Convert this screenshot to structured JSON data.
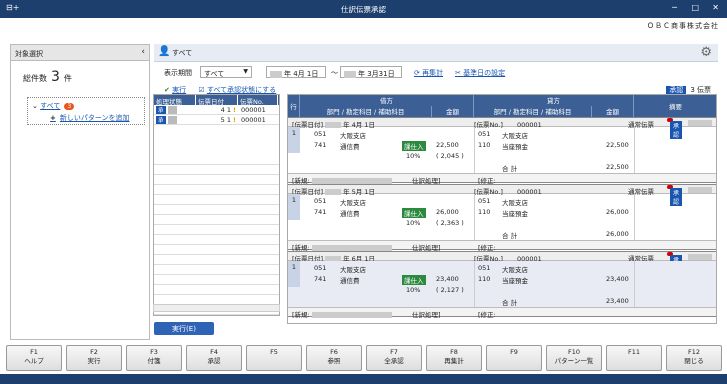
{
  "window": {
    "title": "仕訳伝票承認",
    "company": "ＯＢＣ商事株式会社",
    "controls": [
      "─",
      "□",
      "✕"
    ]
  },
  "left": {
    "header": "対象選択",
    "total_label": "総件数",
    "total_count": "3",
    "total_unit": "件",
    "tree_root": "すべて",
    "tree_badge": "3",
    "tree_add": "新しいパターンを追加"
  },
  "main": {
    "header": "すべて",
    "period_label": "表示期間",
    "period_value": "すべて",
    "date_from": "年 4月 1日",
    "date_to": "年 3月31日",
    "tilde": "～",
    "recalc": "再集計",
    "basedate": "基準日の設定",
    "run_link": "実行",
    "approve_all_link": "すべて承認状態にする",
    "approved_badge": "承認",
    "approved_count": "3 伝票"
  },
  "list": {
    "headers": [
      "処理状態",
      "伝票日付",
      "伝票No."
    ],
    "rows": [
      {
        "status": "承",
        "day": "4",
        "mon": "1",
        "no": "000001"
      },
      {
        "status": "承",
        "day": "5",
        "mon": "1",
        "no": "000001"
      },
      {
        "status": "承",
        "day": "6",
        "mon": "1",
        "no": "000001"
      }
    ],
    "exec_button": "実行(E)"
  },
  "detail": {
    "col_row": "行",
    "debit": "借方",
    "credit": "貸方",
    "dept": "部門 / 勘定科目 / 補助科目",
    "amount": "金額",
    "summary": "摘要",
    "entries": [
      {
        "date": "年 4月 1日",
        "no_label": "[伝票No.]",
        "no": "000001",
        "type": "通常伝票",
        "row": "1",
        "d_dept": "051",
        "d_dept_name": "大阪支店",
        "d_acct": "741",
        "d_acct_name": "通信費",
        "tax": "課仕入",
        "d_amount": "22,500",
        "rate": "10%",
        "d_tax": "( 2,045 )",
        "c_dept": "051",
        "c_dept_name": "大阪支店",
        "c_acct": "110",
        "c_acct_name": "当座預金",
        "c_amount": "22,500",
        "total_label": "合 計",
        "total": "22,500",
        "new_label": "[新規:",
        "proc": "仕訳処理]",
        "mod_label": "[修正:",
        "approve": "承認"
      },
      {
        "date": "年 5月 1日",
        "no_label": "[伝票No.]",
        "no": "000001",
        "type": "通常伝票",
        "row": "1",
        "d_dept": "051",
        "d_dept_name": "大阪支店",
        "d_acct": "741",
        "d_acct_name": "通信費",
        "tax": "課仕入",
        "d_amount": "26,000",
        "rate": "10%",
        "d_tax": "( 2,363 )",
        "c_dept": "051",
        "c_dept_name": "大阪支店",
        "c_acct": "110",
        "c_acct_name": "当座預金",
        "c_amount": "26,000",
        "total_label": "合 計",
        "total": "26,000",
        "new_label": "[新規:",
        "proc": "仕訳処理]",
        "mod_label": "[修正:",
        "approve": "承認"
      },
      {
        "date": "年 6月 1日",
        "no_label": "[伝票No.]",
        "no": "000001",
        "type": "通常伝票",
        "row": "1",
        "d_dept": "051",
        "d_dept_name": "大阪支店",
        "d_acct": "741",
        "d_acct_name": "通信費",
        "tax": "課仕入",
        "d_amount": "23,400",
        "rate": "10%",
        "d_tax": "( 2,127 )",
        "c_dept": "051",
        "c_dept_name": "大阪支店",
        "c_acct": "110",
        "c_acct_name": "当座預金",
        "c_amount": "23,400",
        "total_label": "合 計",
        "total": "23,400",
        "new_label": "[新規:",
        "proc": "仕訳処理]",
        "mod_label": "[修正:",
        "approve": "承認"
      }
    ]
  },
  "fkeys": [
    {
      "k": "F1",
      "l": "ヘルプ"
    },
    {
      "k": "F2",
      "l": "実行"
    },
    {
      "k": "F3",
      "l": "付箋"
    },
    {
      "k": "F4",
      "l": "承認"
    },
    {
      "k": "F5",
      "l": ""
    },
    {
      "k": "F6",
      "l": "参照"
    },
    {
      "k": "F7",
      "l": "全承認"
    },
    {
      "k": "F8",
      "l": "再集計"
    },
    {
      "k": "F9",
      "l": ""
    },
    {
      "k": "F10",
      "l": "パターン一覧"
    },
    {
      "k": "F11",
      "l": ""
    },
    {
      "k": "F12",
      "l": "閉じる"
    }
  ]
}
